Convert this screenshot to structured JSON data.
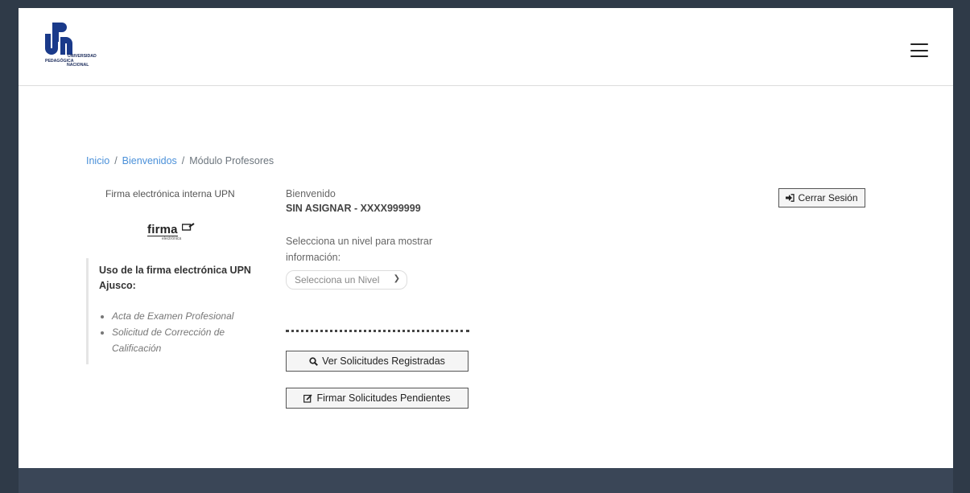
{
  "header": {
    "logo_text_line1": "UNIVERSIDAD",
    "logo_text_line2": "PEDAGÓGICA",
    "logo_text_line3": "NACIONAL",
    "logo_mark": "UPN",
    "menu_icon": "hamburger-icon"
  },
  "breadcrumb": {
    "items": [
      "Inicio",
      "Bienvenidos",
      "Módulo Profesores"
    ],
    "separator": "/"
  },
  "left": {
    "title": "Firma electrónica interna UPN",
    "firma_logo_word": "firma",
    "firma_logo_sub": "electrónica",
    "usage_title": "Uso de la firma electrónica UPN Ajusco:",
    "usage_items": [
      "Acta de Examen Profesional",
      "Solicitud de Corrección de Calificación"
    ]
  },
  "main": {
    "welcome": "Bienvenido",
    "user": "SIN ASIGNAR - XXXX999999",
    "select_prompt": "Selecciona un nivel para mostrar información:",
    "select_value": "Selecciona un Nivel",
    "view_button": "Ver Solicitudes Registradas",
    "sign_button": "Firmar Solicitudes Pendientes"
  },
  "logout_button": "Cerrar Sesión",
  "colors": {
    "outer_bg": "#2f3a48",
    "footer": "#3a4657",
    "link": "#4a90d9",
    "logo_blue": "#1a3a8a"
  }
}
